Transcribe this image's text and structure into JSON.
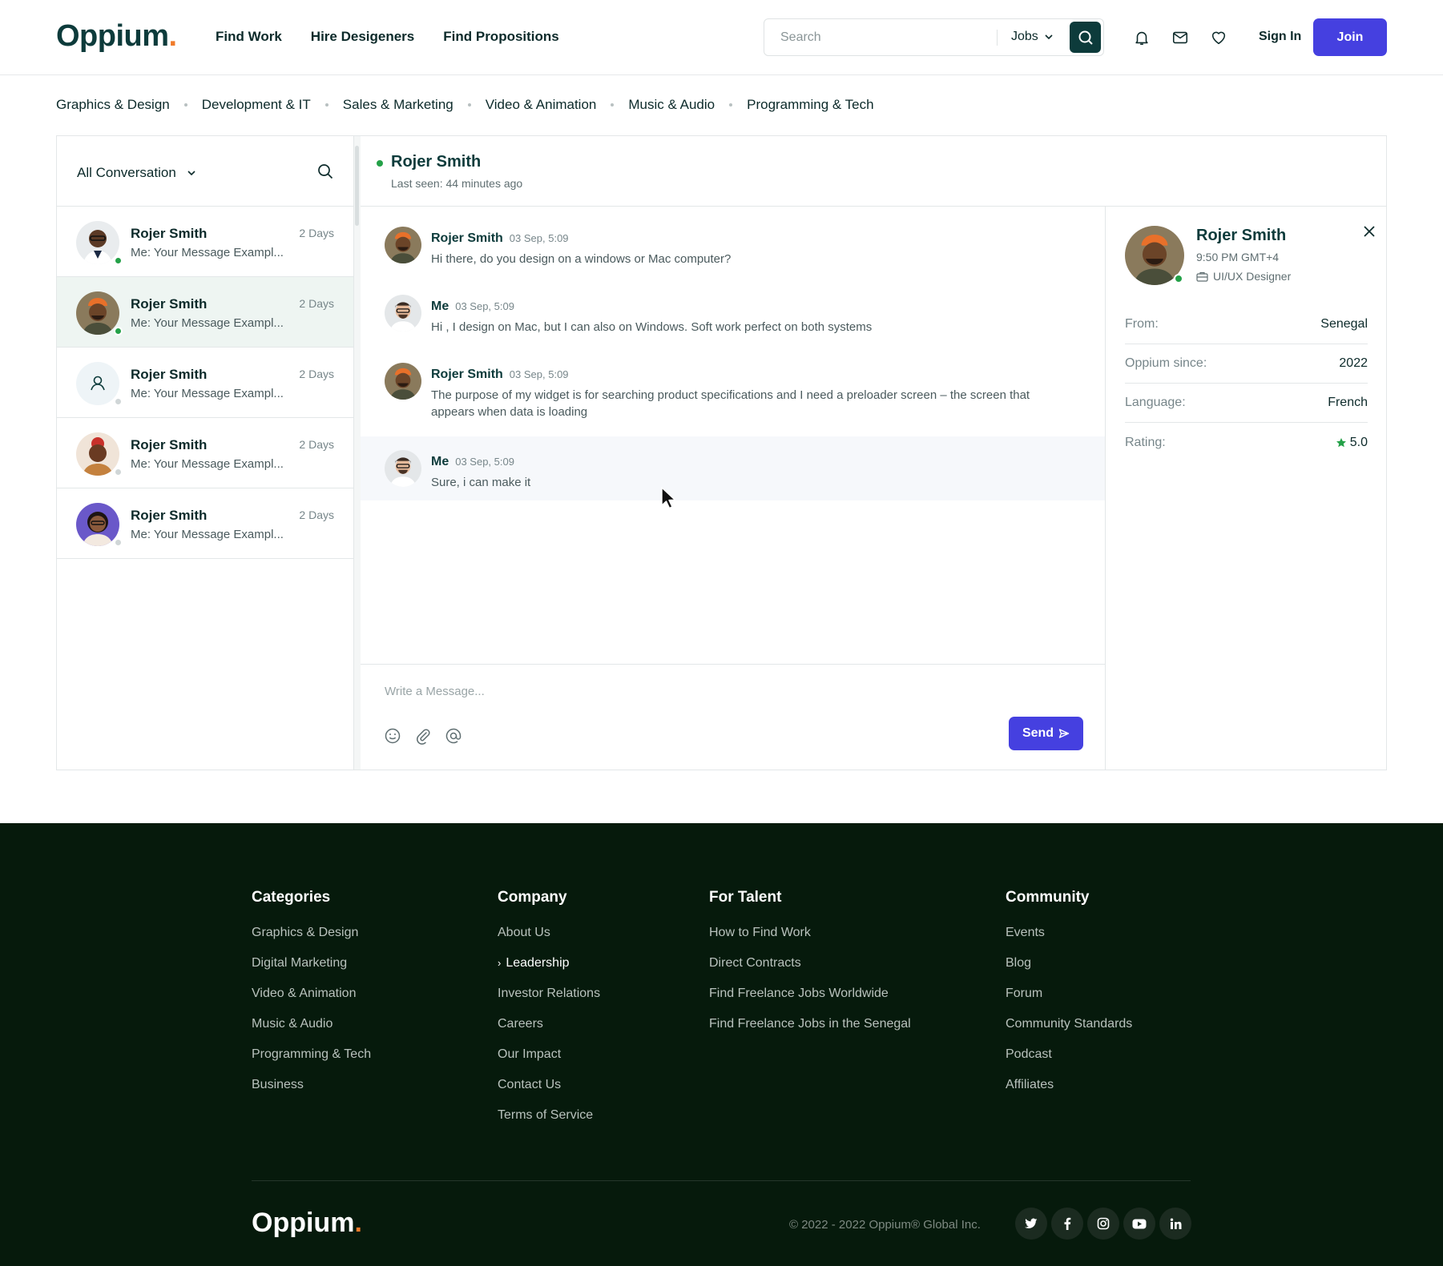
{
  "header": {
    "logo": "Oppium",
    "logo_dot": ".",
    "nav": [
      "Find Work",
      "Hire Desigeners",
      "Find Propositions"
    ],
    "search_placeholder": "Search",
    "search_scope": "Jobs",
    "signin": "Sign In",
    "join": "Join"
  },
  "categories": [
    "Graphics & Design",
    "Development & IT",
    "Sales & Marketing",
    "Video & Animation",
    "Music & Audio",
    "Programming & Tech"
  ],
  "sidebar": {
    "filter": "All Conversation",
    "conversations": [
      {
        "name": "Rojer Smith",
        "time": "2 Days",
        "preview": "Me: Your Message Exampl...",
        "online": true
      },
      {
        "name": "Rojer Smith",
        "time": "2 Days",
        "preview": "Me: Your Message Exampl...",
        "online": true
      },
      {
        "name": "Rojer Smith",
        "time": "2 Days",
        "preview": "Me: Your Message Exampl...",
        "online": false
      },
      {
        "name": "Rojer Smith",
        "time": "2 Days",
        "preview": "Me: Your Message Exampl...",
        "online": false
      },
      {
        "name": "Rojer Smith",
        "time": "2 Days",
        "preview": "Me: Your Message Exampl...",
        "online": false
      }
    ]
  },
  "chat": {
    "title": "Rojer Smith",
    "last_seen": "Last seen: 44 minutes ago",
    "messages": [
      {
        "author": "Rojer Smith",
        "time": "03 Sep, 5:09",
        "text": "Hi there, do you design on a windows or Mac computer?"
      },
      {
        "author": "Me",
        "time": "03 Sep, 5:09",
        "text": "Hi , I design on Mac, but I can also on Windows. Soft work perfect on both systems"
      },
      {
        "author": "Rojer Smith",
        "time": "03 Sep, 5:09",
        "text": "The purpose of my widget is for searching product specifications and I need a preloader screen – the screen that appears when data is loading"
      },
      {
        "author": "Me",
        "time": "03 Sep, 5:09",
        "text": "Sure, i can make it"
      }
    ],
    "composer_placeholder": "Write a Message...",
    "send": "Send"
  },
  "profile": {
    "name": "Rojer Smith",
    "local_time": "9:50 PM GMT+4",
    "role": "UI/UX Designer",
    "rows": [
      {
        "label": "From:",
        "value": "Senegal"
      },
      {
        "label": "Oppium since:",
        "value": "2022"
      },
      {
        "label": "Language:",
        "value": "French"
      },
      {
        "label": "Rating:",
        "value": "5.0"
      }
    ]
  },
  "footer": {
    "columns": [
      {
        "title": "Categories",
        "links": [
          "Graphics & Design",
          "Digital Marketing",
          "Video & Animation",
          "Music & Audio",
          "Programming & Tech",
          "Business"
        ]
      },
      {
        "title": "Company",
        "links": [
          "About Us",
          "Leadership",
          "Investor Relations",
          "Careers",
          "Our Impact",
          "Contact Us",
          "Terms of Service"
        ]
      },
      {
        "title": "For Talent",
        "links": [
          "How to Find Work",
          "Direct Contracts",
          "Find Freelance Jobs Worldwide",
          "Find Freelance Jobs in the Senegal"
        ]
      },
      {
        "title": "Community",
        "links": [
          "Events",
          "Blog",
          "Forum",
          "Community Standards",
          "Podcast",
          "Affiliates"
        ]
      }
    ],
    "logo": "Oppium",
    "logo_dot": ".",
    "copyright": "© 2022 - 2022 Oppium® Global Inc.",
    "socials": [
      "twitter-icon",
      "facebook-icon",
      "instagram-icon",
      "youtube-icon",
      "linkedin-icon"
    ]
  },
  "colors": {
    "brand": "#0d3b3b",
    "accent": "#4540e0",
    "online": "#24a148",
    "footer_bg": "#061a0c",
    "logo_dot": "#f07b2a"
  }
}
